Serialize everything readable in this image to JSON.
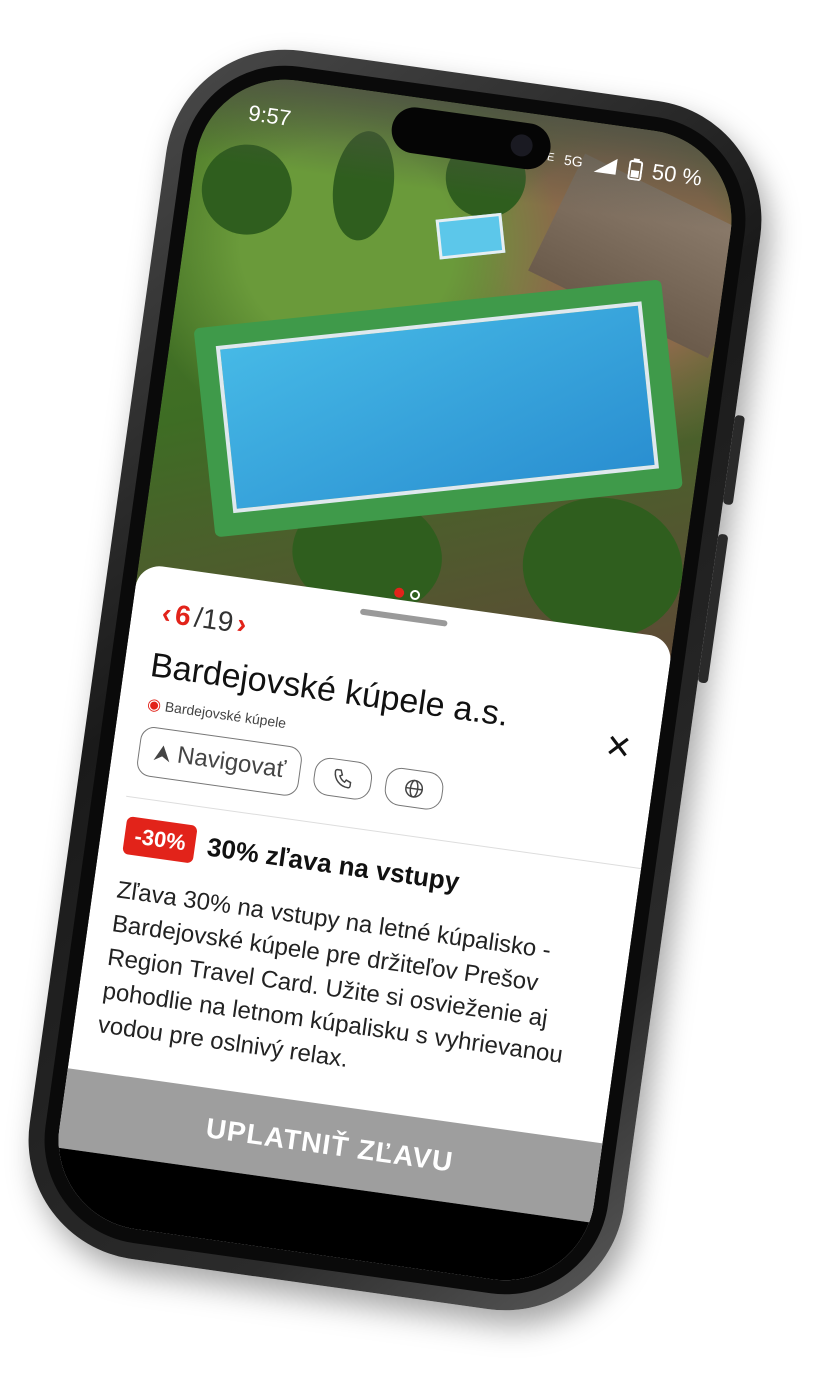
{
  "status_bar": {
    "time": "9:57",
    "network_tiny": "Vo LTE",
    "network": "5G",
    "battery": "50 %"
  },
  "carousel": {
    "dots": 2,
    "active_index": 0
  },
  "pager": {
    "current": "6",
    "separator_total": "/19"
  },
  "place": {
    "title": "Bardejovské kúpele a.s.",
    "location": "Bardejovské kúpele"
  },
  "actions": {
    "navigate_label": "Navigovať"
  },
  "offer": {
    "badge": "-30%",
    "title": "30% zľava na vstupy",
    "description": "Zľava 30% na vstupy na letné kúpalisko - Bardejovské kúpele pre držiteľov Prešov Region Travel Card. Užite si osvieženie aj pohodlie na letnom kúpalisku s vyhrievanou vodou pre oslnivý relax."
  },
  "cta": {
    "label": "UPLATNIŤ ZĽAVU"
  },
  "colors": {
    "accent": "#e2231a",
    "cta_bg": "#9e9e9e"
  }
}
